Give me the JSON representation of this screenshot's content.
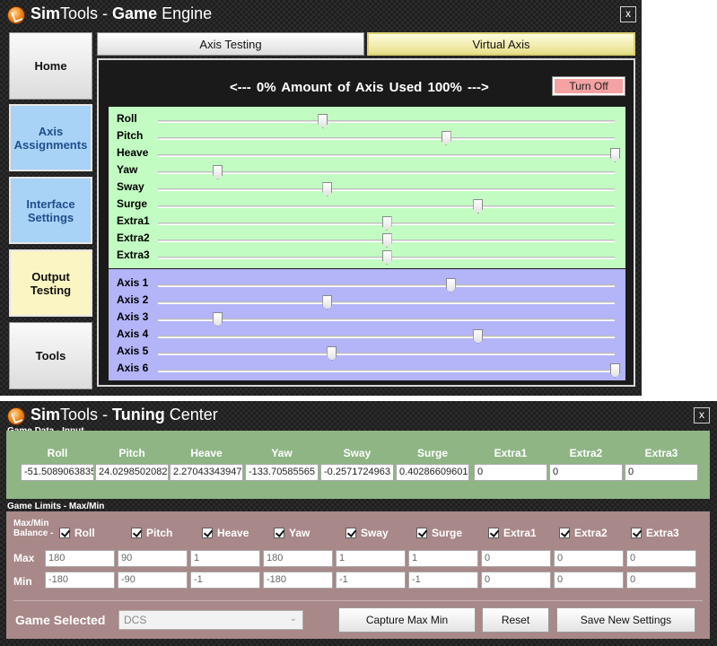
{
  "engine": {
    "title_brand": "Sim",
    "title_brand_rest": "Tools",
    "title_sep": " - ",
    "title_bold": "Game",
    "title_rest": " Engine",
    "close": "x",
    "sidebar": [
      {
        "id": "home",
        "label": "Home",
        "style": "grey"
      },
      {
        "id": "axis-assignments",
        "label": "Axis Assignments",
        "style": "blue"
      },
      {
        "id": "interface-settings",
        "label": "Interface Settings",
        "style": "blue"
      },
      {
        "id": "output-testing",
        "label": "Output Testing",
        "style": "yellow"
      },
      {
        "id": "tools",
        "label": "Tools",
        "style": "grey"
      }
    ],
    "tabs": {
      "axis_testing": "Axis Testing",
      "virtual_axis": "Virtual Axis"
    },
    "amount_label": "<--- 0%    Amount of Axis Used    100% --->",
    "turn_off": "Turn Off",
    "game_axes": [
      {
        "label": "Roll",
        "value": 36
      },
      {
        "label": "Pitch",
        "value": 63
      },
      {
        "label": "Heave",
        "value": 100
      },
      {
        "label": "Yaw",
        "value": 13
      },
      {
        "label": "Sway",
        "value": 37
      },
      {
        "label": "Surge",
        "value": 70
      },
      {
        "label": "Extra1",
        "value": 50
      },
      {
        "label": "Extra2",
        "value": 50
      },
      {
        "label": "Extra3",
        "value": 50
      }
    ],
    "virtual_axes": [
      {
        "label": "Axis 1",
        "value": 64
      },
      {
        "label": "Axis 2",
        "value": 37
      },
      {
        "label": "Axis 3",
        "value": 13
      },
      {
        "label": "Axis 4",
        "value": 70
      },
      {
        "label": "Axis 5",
        "value": 38
      },
      {
        "label": "Axis 6",
        "value": 100
      }
    ],
    "colors": {
      "green_panel": "#c2fcc2",
      "violet_panel": "#b4b4f8",
      "turn_off_bg": "#f4a2a2"
    }
  },
  "tuning": {
    "title_brand": "Sim",
    "title_brand_rest": "Tools",
    "title_sep": " - ",
    "title_bold": "Tuning",
    "title_rest": " Center",
    "close": "x",
    "game_data_label": "Game Data - Input",
    "game_limits_label": "Game Limits - Max/Min",
    "maxmin_balance_label": "Max/Min\nBalance -",
    "max_label": "Max",
    "min_label": "Min",
    "columns": [
      {
        "name": "Roll",
        "input": "-51.5089063835",
        "checked": true,
        "max": "180",
        "min": "-180"
      },
      {
        "name": "Pitch",
        "input": "24.0298502082",
        "checked": true,
        "max": "90",
        "min": "-90"
      },
      {
        "name": "Heave",
        "input": "2.27043343947",
        "checked": true,
        "max": "1",
        "min": "-1"
      },
      {
        "name": "Yaw",
        "input": "-133.70585565",
        "checked": true,
        "max": "180",
        "min": "-180"
      },
      {
        "name": "Sway",
        "input": "-0.2571724963",
        "checked": true,
        "max": "1",
        "min": "-1"
      },
      {
        "name": "Surge",
        "input": "0.40286609601",
        "checked": true,
        "max": "1",
        "min": "-1"
      },
      {
        "name": "Extra1",
        "input": "0",
        "checked": true,
        "max": "0",
        "min": "0"
      },
      {
        "name": "Extra2",
        "input": "0",
        "checked": true,
        "max": "0",
        "min": "0"
      },
      {
        "name": "Extra3",
        "input": "0",
        "checked": true,
        "max": "0",
        "min": "0"
      }
    ],
    "game_selected_label": "Game Selected",
    "game_selected_value": "DCS",
    "buttons": {
      "capture": "Capture Max Min",
      "reset": "Reset",
      "save": "Save New Settings"
    },
    "colors": {
      "data_panel": "#8fb585",
      "limits_panel": "#a88888"
    }
  }
}
